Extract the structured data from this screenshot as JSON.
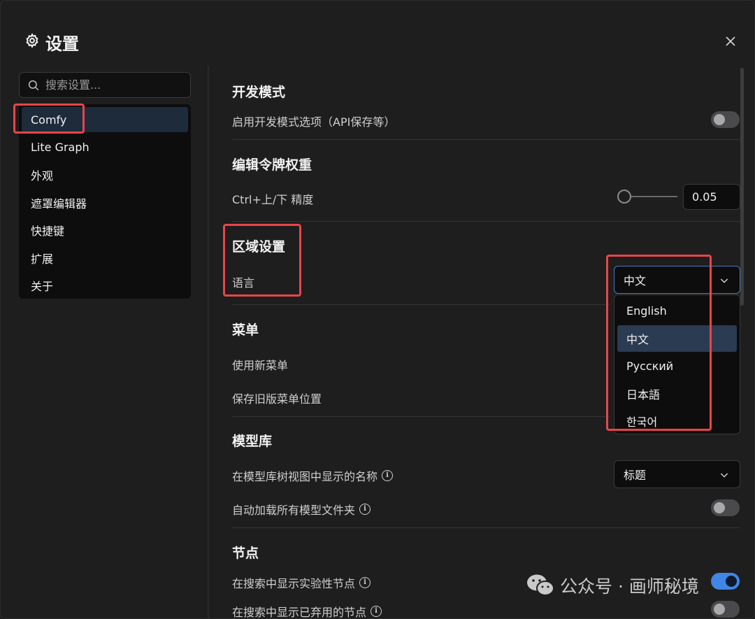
{
  "dialog": {
    "title": "设置"
  },
  "search": {
    "placeholder": "搜索设置..."
  },
  "sidebar": {
    "items": [
      {
        "label": "Comfy"
      },
      {
        "label": "Lite Graph"
      },
      {
        "label": "外观"
      },
      {
        "label": "遮罩编辑器"
      },
      {
        "label": "快捷键"
      },
      {
        "label": "扩展"
      },
      {
        "label": "关于"
      }
    ],
    "active_index": 0
  },
  "sections": {
    "dev": {
      "title": "开发模式",
      "row_label": "启用开发模式选项（API保存等）",
      "toggle_on": false
    },
    "token": {
      "title": "编辑令牌权重",
      "row_label": "Ctrl+上/下 精度",
      "value": "0.05"
    },
    "locale": {
      "title": "区域设置",
      "row_label": "语言",
      "selected": "中文"
    },
    "menu": {
      "title": "菜单",
      "row1": "使用新菜单",
      "row2": "保存旧版菜单位置"
    },
    "model_lib": {
      "title": "模型库",
      "row1": "在模型库树视图中显示的名称",
      "row1_value": "标题",
      "row2": "自动加载所有模型文件夹",
      "row2_toggle_on": false
    },
    "node": {
      "title": "节点",
      "row1": "在搜索中显示实验性节点",
      "row1_toggle_on": true,
      "row2": "在搜索中显示已弃用的节点",
      "row2_toggle_on": false
    }
  },
  "language_options": [
    "English",
    "中文",
    "Русский",
    "日本語",
    "한국어"
  ],
  "language_selected_index": 1,
  "watermark": {
    "text": "公众号 · 画师秘境"
  },
  "colors": {
    "accent": "#3f86e6",
    "highlight_box": "#e8454a",
    "active_nav": "#1d2b3b"
  }
}
